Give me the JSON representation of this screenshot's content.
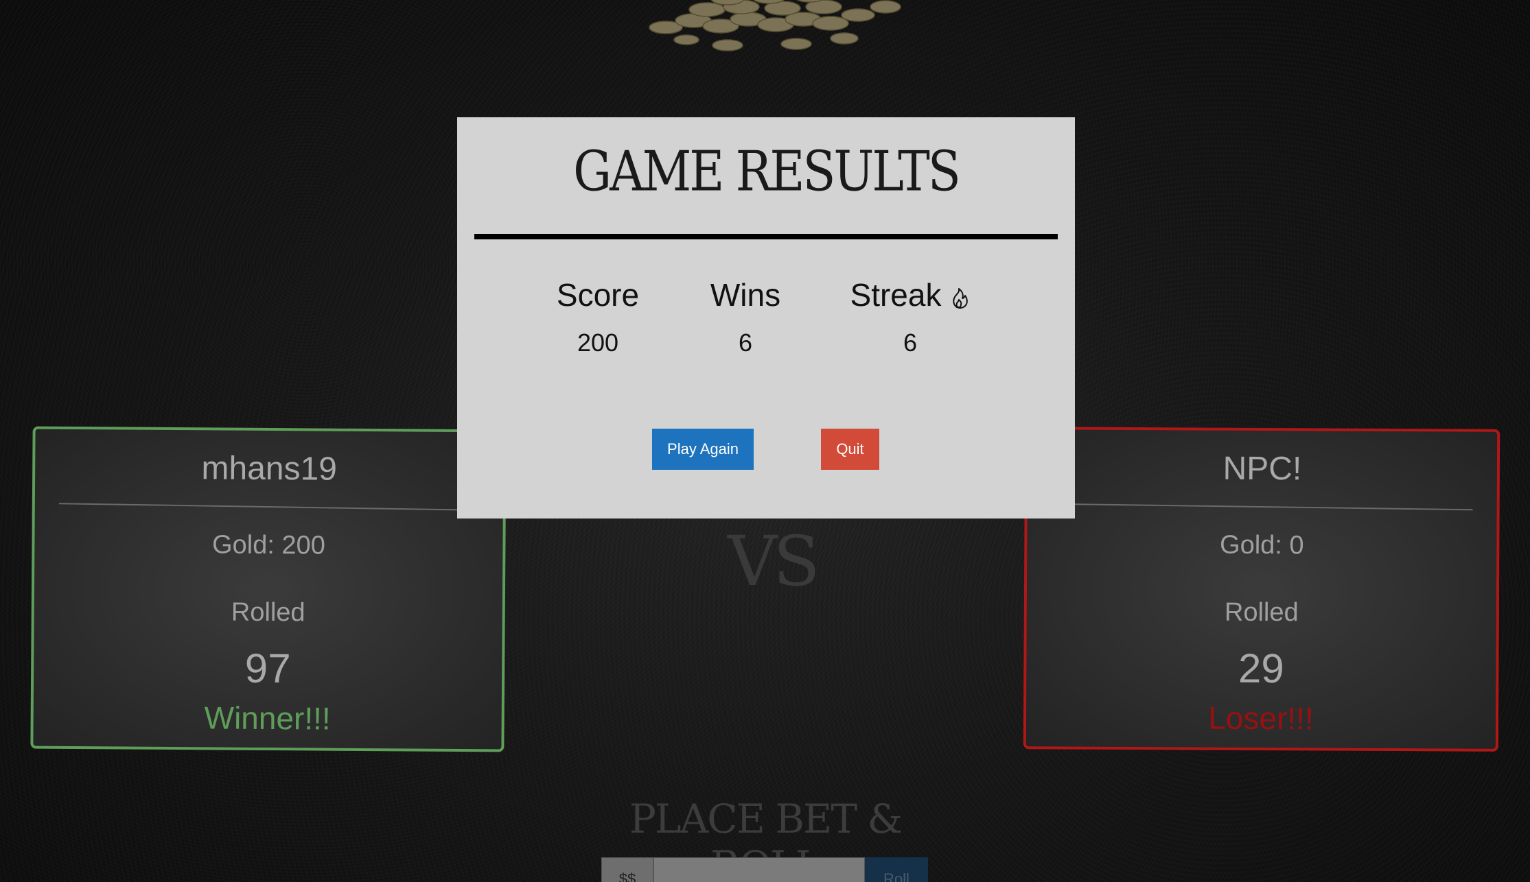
{
  "modal": {
    "title": "GAME RESULTS",
    "stats": {
      "score_label": "Score",
      "score_value": "200",
      "wins_label": "Wins",
      "wins_value": "6",
      "streak_label": "Streak",
      "streak_value": "6",
      "streak_icon": "flame-icon"
    },
    "play_again_label": "Play Again",
    "quit_label": "Quit"
  },
  "player": {
    "name": "mhans19",
    "gold": "Gold: 200",
    "rolled_label": "Rolled",
    "rolled_value": "97",
    "result": "Winner!!!"
  },
  "npc": {
    "name": "NPC!",
    "gold": "Gold: 0",
    "rolled_label": "Rolled",
    "rolled_value": "29",
    "result": "Loser!!!"
  },
  "vs_label": "VS",
  "place_bet_label": "PLACE BET & ROLL",
  "bet": {
    "prefix": "$$",
    "value": "",
    "roll_label": "Roll"
  },
  "colors": {
    "winner": "#5e9e5a",
    "loser": "#b01818",
    "play_again": "#1e73be",
    "quit": "#d24a38",
    "modal_bg": "#d3d3d3"
  }
}
